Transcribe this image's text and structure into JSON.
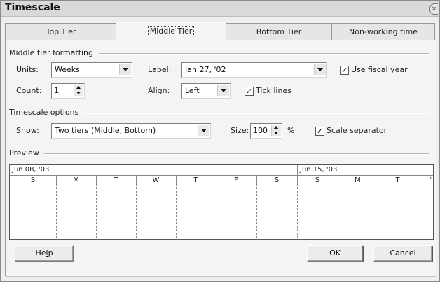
{
  "window": {
    "title": "Timescale",
    "close_glyph": "×"
  },
  "tabs": [
    {
      "label": "Top Tier",
      "active": false
    },
    {
      "label": "Middle Tier",
      "active": true
    },
    {
      "label": "Bottom Tier",
      "active": false
    },
    {
      "label": "Non-working time",
      "active": false
    }
  ],
  "middle_tier_formatting": {
    "group_label": "Middle tier formatting",
    "units_label_pre": "",
    "units_label_u": "U",
    "units_label_post": "nits:",
    "units_value": "Weeks",
    "label_label_u": "L",
    "label_label_post": "abel:",
    "label_value": "Jan 27, '02",
    "use_fiscal_pre": "Use ",
    "use_fiscal_u": "f",
    "use_fiscal_post": "iscal year",
    "use_fiscal_checked": true,
    "count_label_pre": "Cou",
    "count_label_u": "n",
    "count_label_post": "t:",
    "count_value": "1",
    "align_label_u": "A",
    "align_label_post": "lign:",
    "align_value": "Left",
    "tick_lines_u": "T",
    "tick_lines_post": "ick lines",
    "tick_lines_checked": true
  },
  "timescale_options": {
    "group_label": "Timescale options",
    "show_label_pre": "S",
    "show_label_u": "h",
    "show_label_post": "ow:",
    "show_value": "Two tiers (Middle, Bottom)",
    "size_label_pre": "S",
    "size_label_u": "i",
    "size_label_post": "ze:",
    "size_value": "100",
    "size_unit": "%",
    "scale_sep_u": "S",
    "scale_sep_post": "cale separator",
    "scale_sep_checked": true
  },
  "preview": {
    "group_label": "Preview",
    "middle_labels": [
      "Jun 08, '03",
      "Jun 15, '03"
    ],
    "days": [
      "S",
      "M",
      "T",
      "W",
      "T",
      "F",
      "S",
      "S",
      "M",
      "T",
      "'"
    ]
  },
  "buttons": {
    "help_pre": "He",
    "help_u": "l",
    "help_post": "p",
    "ok": "OK",
    "cancel": "Cancel"
  }
}
